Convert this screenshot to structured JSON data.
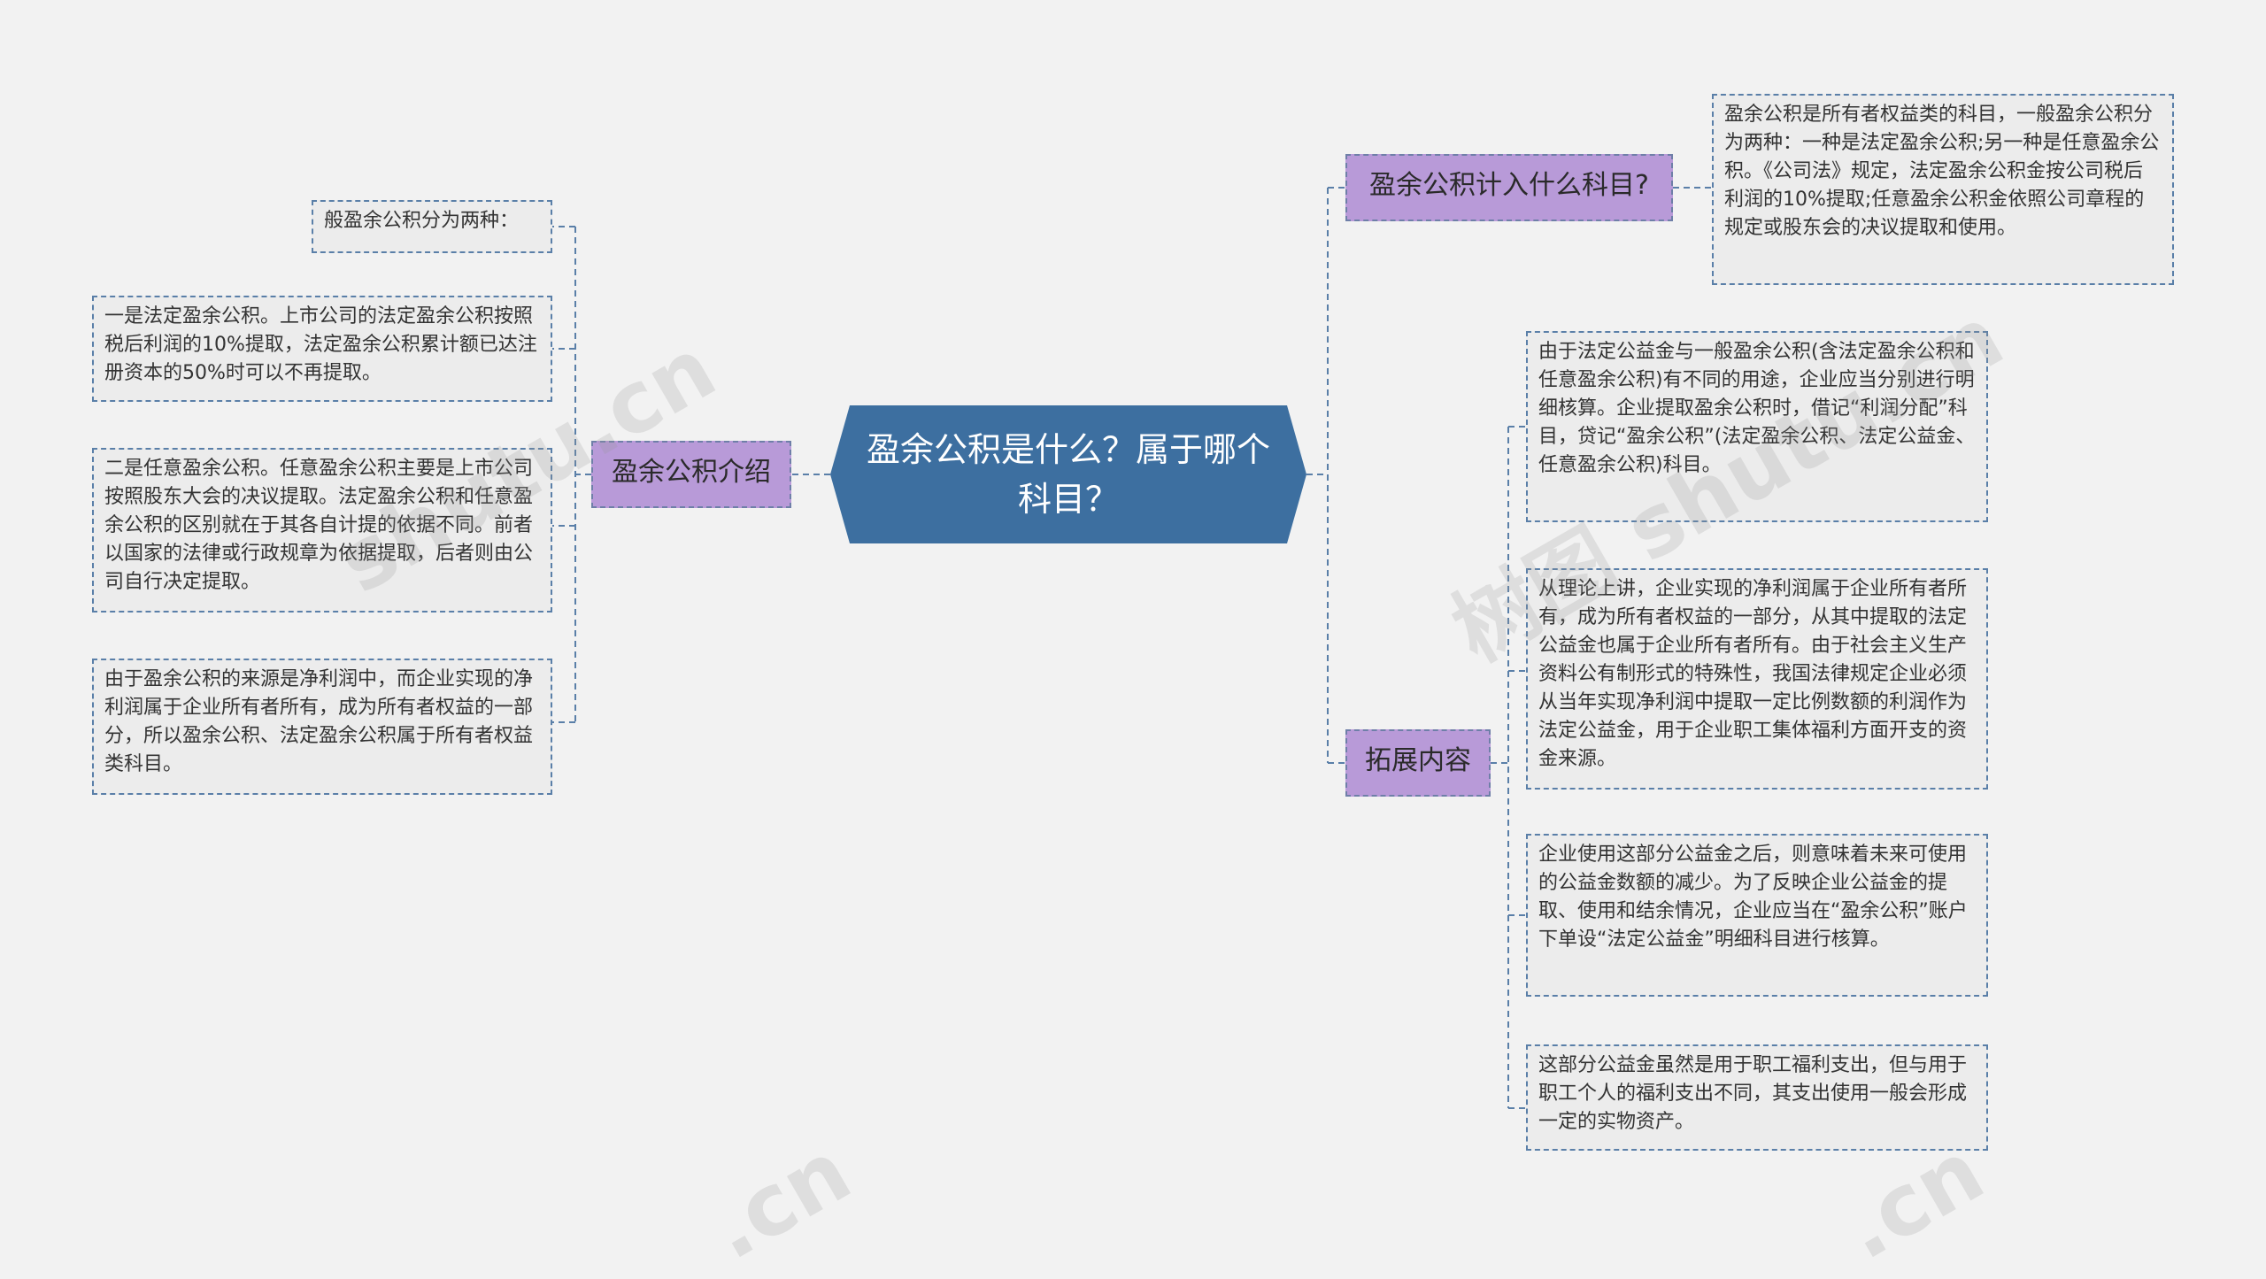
{
  "root": {
    "label": "盈余公积是什么？属于哪个科目？"
  },
  "branches": {
    "intro": {
      "label": "盈余公积介绍",
      "leaves": [
        "般盈余公积分为两种：",
        "一是法定盈余公积。上市公司的法定盈余公积按照税后利润的10%提取，法定盈余公积累计额已达注册资本的50%时可以不再提取。",
        "二是任意盈余公积。任意盈余公积主要是上市公司按照股东大会的决议提取。法定盈余公积和任意盈余公积的区别就在于其各自计提的依据不同。前者以国家的法律或行政规章为依据提取，后者则由公司自行决定提取。",
        "由于盈余公积的来源是净利润中，而企业实现的净利润属于企业所有者所有，成为所有者权益的一部分，所以盈余公积、法定盈余公积属于所有者权益类科目。"
      ]
    },
    "subject": {
      "label": "盈余公积计入什么科目?",
      "leaves": [
        "盈余公积是所有者权益类的科目，一般盈余公积分为两种：一种是法定盈余公积;另一种是任意盈余公积。《公司法》规定，法定盈余公积金按公司税后利润的10%提取;任意盈余公积金依照公司章程的规定或股东会的决议提取和使用。"
      ]
    },
    "extend": {
      "label": "拓展内容",
      "leaves": [
        "由于法定公益金与一般盈余公积(含法定盈余公积和任意盈余公积)有不同的用途，企业应当分别进行明细核算。企业提取盈余公积时，借记“利润分配”科目，贷记“盈余公积”(法定盈余公积、法定公益金、任意盈余公积)科目。",
        "从理论上讲，企业实现的净利润属于企业所有者所有，成为所有者权益的一部分，从其中提取的法定公益金也属于企业所有者所有。由于社会主义生产资料公有制形式的特殊性，我国法律规定企业必须从当年实现净利润中提取一定比例数额的利润作为法定公益金，用于企业职工集体福利方面开支的资金来源。",
        "企业使用这部分公益金之后，则意味着未来可使用的公益金数额的减少。为了反映企业公益金的提取、使用和结余情况，企业应当在“盈余公积”账户下单设“法定公益金”明细科目进行核算。",
        "这部分公益金虽然是用于职工福利支出，但与用于职工个人的福利支出不同，其支出使用一般会形成一定的实物资产。"
      ]
    }
  },
  "watermarks": [
    "shutu.cn",
    "树图 shutu.cn",
    ".cn",
    ".cn"
  ],
  "colors": {
    "background": "#f2f2f2",
    "root_fill": "#3d6fa0",
    "branch_fill": "#b89ad8",
    "leaf_fill": "#ececec",
    "connector": "#5a7fa8"
  }
}
